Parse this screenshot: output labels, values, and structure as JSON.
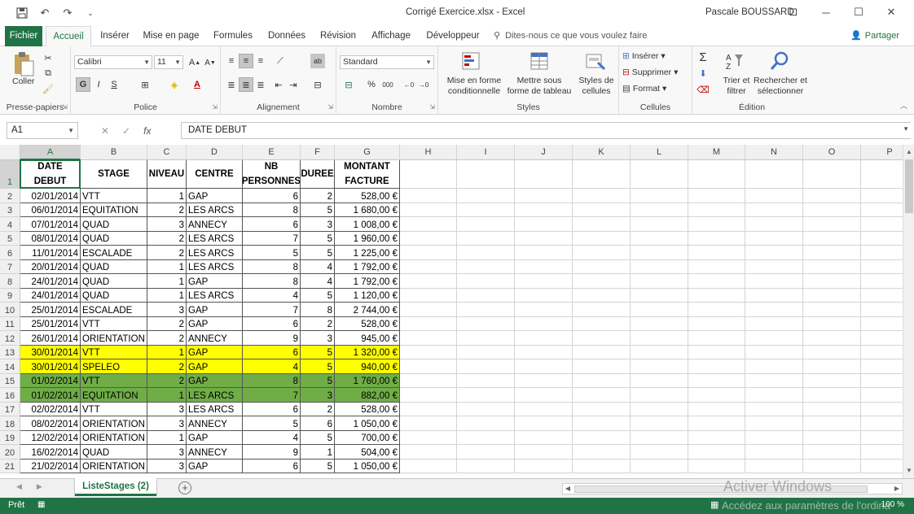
{
  "window": {
    "title": "Corrigé Exercice.xlsx  -  Excel",
    "user": "Pascale BOUSSARD",
    "minimize": "─",
    "restore": "☐",
    "close": "✕",
    "ribbon_display": "⊡"
  },
  "qat": {
    "save": "💾",
    "undo": "↶",
    "redo": "↷",
    "customize": "⌄"
  },
  "tabs": [
    {
      "label": "Fichier"
    },
    {
      "label": "Accueil"
    },
    {
      "label": "Insérer"
    },
    {
      "label": "Mise en page"
    },
    {
      "label": "Formules"
    },
    {
      "label": "Données"
    },
    {
      "label": "Révision"
    },
    {
      "label": "Affichage"
    },
    {
      "label": "Développeur"
    }
  ],
  "tell_me": "Dites-nous ce que vous voulez faire",
  "share": "Partager",
  "ribbon": {
    "clipboard": {
      "label": "Presse-papiers",
      "paste": "Coller"
    },
    "font": {
      "label": "Police",
      "name": "Calibri",
      "size": "11",
      "bold": "G",
      "italic": "I",
      "underline": "S"
    },
    "alignment": {
      "label": "Alignement"
    },
    "number": {
      "label": "Nombre",
      "format": "Standard",
      "percent": "%",
      "thousands": "000"
    },
    "styles": {
      "label": "Styles",
      "conditional": "Mise en forme conditionnelle",
      "table": "Mettre sous forme de tableau",
      "cell_styles": "Styles de cellules"
    },
    "cells": {
      "label": "Cellules",
      "insert": "Insérer",
      "delete": "Supprimer",
      "format": "Format"
    },
    "editing": {
      "label": "Édition",
      "sort": "Trier et filtrer",
      "find": "Rechercher et sélectionner"
    }
  },
  "formula_bar": {
    "name_box": "A1",
    "formula": "DATE DEBUT",
    "fx": "fx"
  },
  "columns": [
    "A",
    "B",
    "C",
    "D",
    "E",
    "F",
    "G",
    "H",
    "I",
    "J",
    "K",
    "L",
    "M",
    "N",
    "O",
    "P"
  ],
  "headers": [
    "DATE DEBUT",
    "STAGE",
    "NIVEAU",
    "CENTRE",
    "NB PERSONNES",
    "DUREE",
    "MONTANT FACTURE"
  ],
  "rows": [
    {
      "n": "2",
      "date": "02/01/2014",
      "stage": "VTT",
      "niveau": "1",
      "centre": "GAP",
      "nb": "6",
      "duree": "2",
      "montant": "528,00 €"
    },
    {
      "n": "3",
      "date": "06/01/2014",
      "stage": "EQUITATION",
      "niveau": "2",
      "centre": "LES ARCS",
      "nb": "8",
      "duree": "5",
      "montant": "1 680,00 €"
    },
    {
      "n": "4",
      "date": "07/01/2014",
      "stage": "QUAD",
      "niveau": "3",
      "centre": "ANNECY",
      "nb": "6",
      "duree": "3",
      "montant": "1 008,00 €"
    },
    {
      "n": "5",
      "date": "08/01/2014",
      "stage": "QUAD",
      "niveau": "2",
      "centre": "LES ARCS",
      "nb": "7",
      "duree": "5",
      "montant": "1 960,00 €"
    },
    {
      "n": "6",
      "date": "11/01/2014",
      "stage": "ESCALADE",
      "niveau": "2",
      "centre": "LES ARCS",
      "nb": "5",
      "duree": "5",
      "montant": "1 225,00 €"
    },
    {
      "n": "7",
      "date": "20/01/2014",
      "stage": "QUAD",
      "niveau": "1",
      "centre": "LES ARCS",
      "nb": "8",
      "duree": "4",
      "montant": "1 792,00 €"
    },
    {
      "n": "8",
      "date": "24/01/2014",
      "stage": "QUAD",
      "niveau": "1",
      "centre": "GAP",
      "nb": "8",
      "duree": "4",
      "montant": "1 792,00 €"
    },
    {
      "n": "9",
      "date": "24/01/2014",
      "stage": "QUAD",
      "niveau": "1",
      "centre": "LES ARCS",
      "nb": "4",
      "duree": "5",
      "montant": "1 120,00 €"
    },
    {
      "n": "10",
      "date": "25/01/2014",
      "stage": "ESCALADE",
      "niveau": "3",
      "centre": "GAP",
      "nb": "7",
      "duree": "8",
      "montant": "2 744,00 €"
    },
    {
      "n": "11",
      "date": "25/01/2014",
      "stage": "VTT",
      "niveau": "2",
      "centre": "GAP",
      "nb": "6",
      "duree": "2",
      "montant": "528,00 €"
    },
    {
      "n": "12",
      "date": "26/01/2014",
      "stage": "ORIENTATION",
      "niveau": "2",
      "centre": "ANNECY",
      "nb": "9",
      "duree": "3",
      "montant": "945,00 €"
    },
    {
      "n": "13",
      "date": "30/01/2014",
      "stage": "VTT",
      "niveau": "1",
      "centre": "GAP",
      "nb": "6",
      "duree": "5",
      "montant": "1 320,00 €",
      "fill": "#ffff00"
    },
    {
      "n": "14",
      "date": "30/01/2014",
      "stage": "SPELEO",
      "niveau": "2",
      "centre": "GAP",
      "nb": "4",
      "duree": "5",
      "montant": "940,00 €",
      "fill": "#ffff00"
    },
    {
      "n": "15",
      "date": "01/02/2014",
      "stage": "VTT",
      "niveau": "2",
      "centre": "GAP",
      "nb": "8",
      "duree": "5",
      "montant": "1 760,00 €",
      "fill": "#70ad47"
    },
    {
      "n": "16",
      "date": "01/02/2014",
      "stage": "EQUITATION",
      "niveau": "1",
      "centre": "LES ARCS",
      "nb": "7",
      "duree": "3",
      "montant": "882,00 €",
      "fill": "#70ad47"
    },
    {
      "n": "17",
      "date": "02/02/2014",
      "stage": "VTT",
      "niveau": "3",
      "centre": "LES ARCS",
      "nb": "6",
      "duree": "2",
      "montant": "528,00 €"
    },
    {
      "n": "18",
      "date": "08/02/2014",
      "stage": "ORIENTATION",
      "niveau": "3",
      "centre": "ANNECY",
      "nb": "5",
      "duree": "6",
      "montant": "1 050,00 €"
    },
    {
      "n": "19",
      "date": "12/02/2014",
      "stage": "ORIENTATION",
      "niveau": "1",
      "centre": "GAP",
      "nb": "4",
      "duree": "5",
      "montant": "700,00 €"
    },
    {
      "n": "20",
      "date": "16/02/2014",
      "stage": "QUAD",
      "niveau": "3",
      "centre": "ANNECY",
      "nb": "9",
      "duree": "1",
      "montant": "504,00 €"
    },
    {
      "n": "21",
      "date": "21/02/2014",
      "stage": "ORIENTATION",
      "niveau": "3",
      "centre": "GAP",
      "nb": "6",
      "duree": "5",
      "montant": "1 050,00 €"
    }
  ],
  "sheet": {
    "tab": "ListeStages (2)",
    "add": "+"
  },
  "watermark": "Activer Windows",
  "watermark_sub": "Accédez aux paramètres de l'ordina",
  "status": {
    "ready": "Prêt",
    "zoom": "100 %"
  },
  "colors": {
    "accent": "#217346",
    "highlight_yellow": "#ffff00",
    "highlight_green": "#70ad47"
  }
}
